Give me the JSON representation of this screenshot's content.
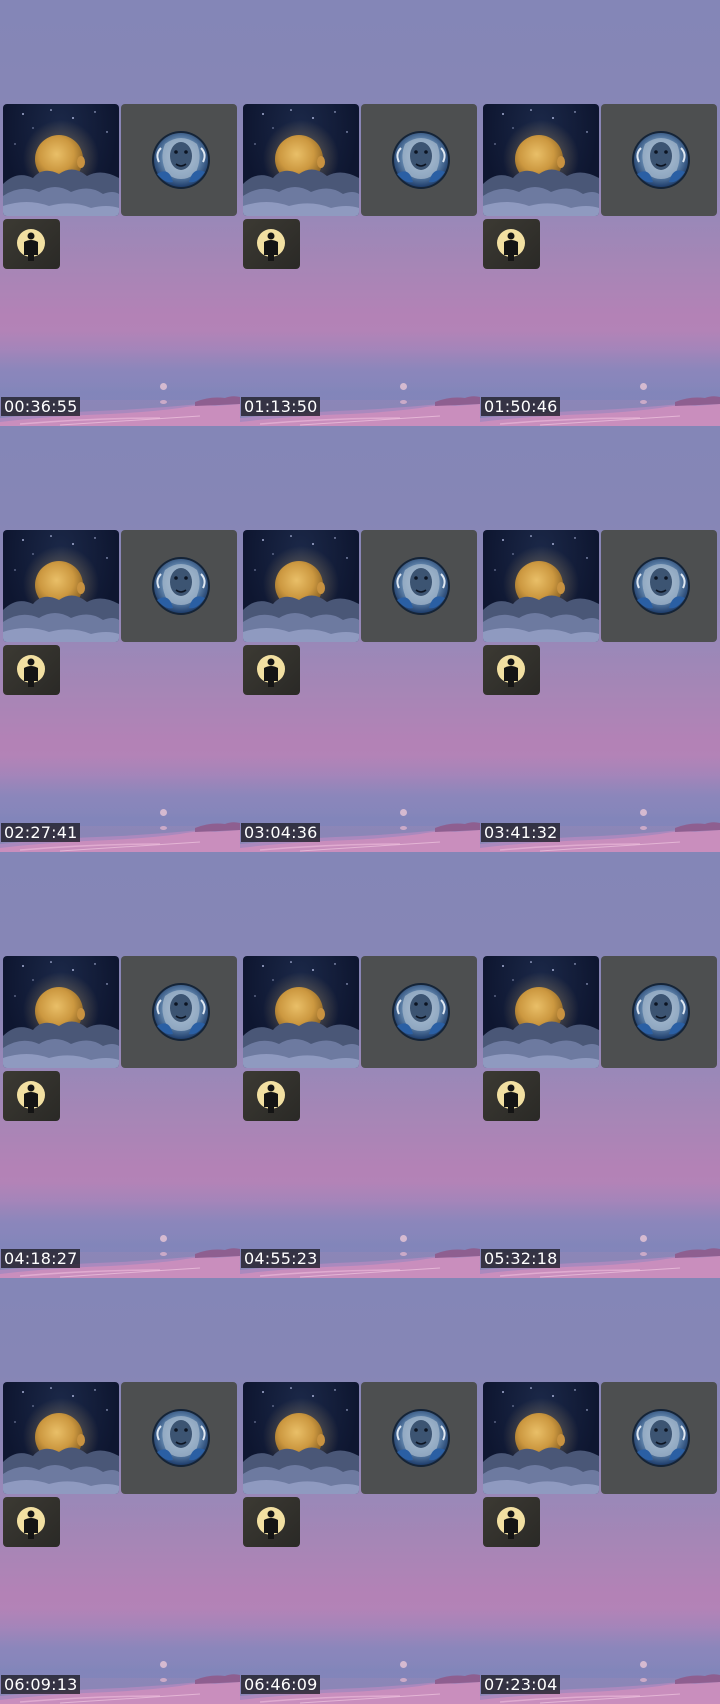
{
  "frames": [
    {
      "timestamp": "00:36:55"
    },
    {
      "timestamp": "01:13:50"
    },
    {
      "timestamp": "01:50:46"
    },
    {
      "timestamp": "02:27:41"
    },
    {
      "timestamp": "03:04:36"
    },
    {
      "timestamp": "03:41:32"
    },
    {
      "timestamp": "04:18:27"
    },
    {
      "timestamp": "04:55:23"
    },
    {
      "timestamp": "05:32:18"
    },
    {
      "timestamp": "06:09:13"
    },
    {
      "timestamp": "06:46:09"
    },
    {
      "timestamp": "07:23:04"
    }
  ],
  "tiles": {
    "moon": {
      "icon": "moon-clouds-icon"
    },
    "lion": {
      "icon": "lion-portrait-icon"
    },
    "person": {
      "icon": "person-silhouette-icon"
    }
  },
  "colors": {
    "sky_top": "#8486b7",
    "sky_pink": "#b382b6",
    "shore_pink": "#d98fb9",
    "moon_gold": "#d6a64a",
    "stamp_bg": "#141418"
  }
}
